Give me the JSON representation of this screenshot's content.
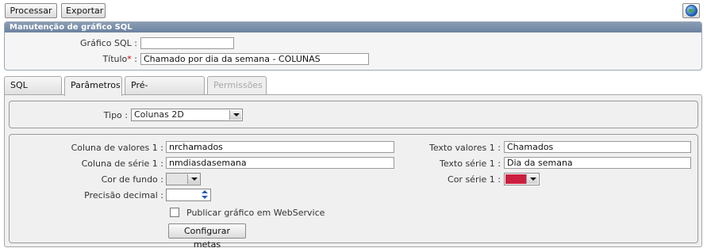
{
  "toolbar": {
    "process_label": "Processar",
    "export_label": "Exportar",
    "help_icon": "globe-help-icon"
  },
  "panel": {
    "title": "Manutenção de gráfico SQL",
    "grafico_label": "Gráfico SQL :",
    "grafico_value": "",
    "titulo_label": "Título",
    "titulo_required": "*",
    "titulo_colon": " :",
    "titulo_value": "Chamado por dia da semana - COLUNAS"
  },
  "tabs": [
    {
      "label": "SQL Query"
    },
    {
      "label": "Parâmetros"
    },
    {
      "label": "Pré-visualização"
    },
    {
      "label": "Permissões"
    }
  ],
  "params": {
    "tipo_label": "Tipo :",
    "tipo_value": "Colunas 2D",
    "coluna_valores_label": "Coluna de valores 1 :",
    "coluna_valores_value": "nrchamados",
    "coluna_serie_label": "Coluna de série 1 :",
    "coluna_serie_value": "nmdiasdasemana",
    "cor_fundo_label": "Cor de fundo :",
    "precisao_label": "Precisão decimal :",
    "publicar_label": "Publicar gráfico em WebService",
    "publicar_checked": false,
    "configurar_label": "Configurar metas",
    "texto_valores_label": "Texto valores 1 :",
    "texto_valores_value": "Chamados",
    "texto_serie_label": "Texto série 1 :",
    "texto_serie_value": "Dia da semana",
    "cor_serie_label": "Cor série 1 :",
    "cor_serie_color": "#cc1f3f"
  }
}
